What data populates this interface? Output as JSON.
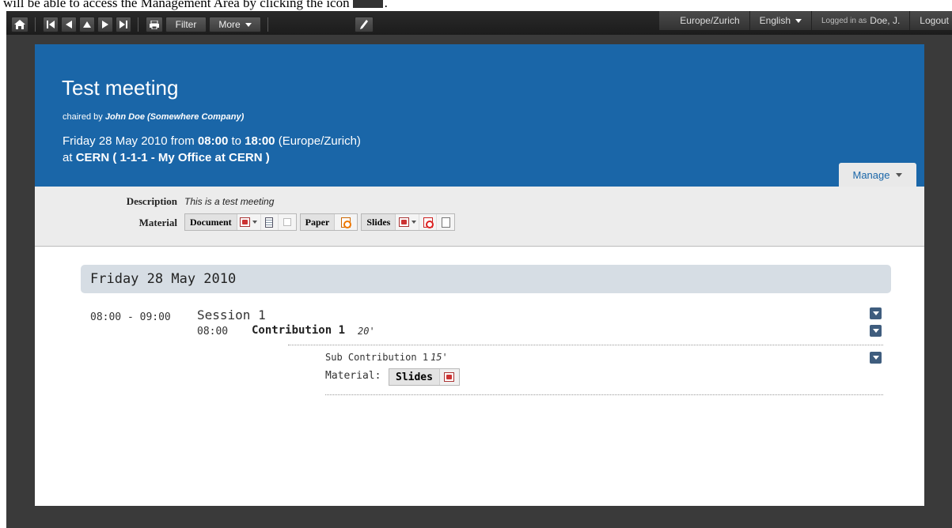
{
  "doc_snippet": {
    "text": "will be able to access the Management Area by clicking the icon",
    "suffix": "."
  },
  "toolbar": {
    "filter_label": "Filter",
    "more_label": "More",
    "timezone": "Europe/Zurich",
    "language": "English",
    "logged_in_prefix": "Logged in as",
    "user": "Doe, J.",
    "logout": "Logout"
  },
  "event": {
    "title": "Test meeting",
    "chaired_prefix": "chaired by",
    "chair": "John Doe (Somewhere Company)",
    "date_prefix": "Friday 28 May 2010 from",
    "start": "08:00",
    "to": "to",
    "end": "18:00",
    "tz": "(Europe/Zurich)",
    "at_prefix": "at",
    "location": "CERN ( 1-1-1 - My Office at CERN )",
    "manage_label": "Manage"
  },
  "info": {
    "description_label": "Description",
    "description_value": "This is a test meeting",
    "material_label": "Material",
    "materials": [
      "Document",
      "Paper",
      "Slides"
    ]
  },
  "timetable": {
    "day": "Friday 28 May 2010",
    "session_time": "08:00 - 09:00",
    "session_title": "Session 1",
    "contribution_time": "08:00",
    "contribution_title": "Contribution 1",
    "contribution_duration": "20'",
    "sub_title": "Sub Contribution 1",
    "sub_duration": "15'",
    "sub_material_label": "Material:",
    "sub_slides_label": "Slides"
  }
}
